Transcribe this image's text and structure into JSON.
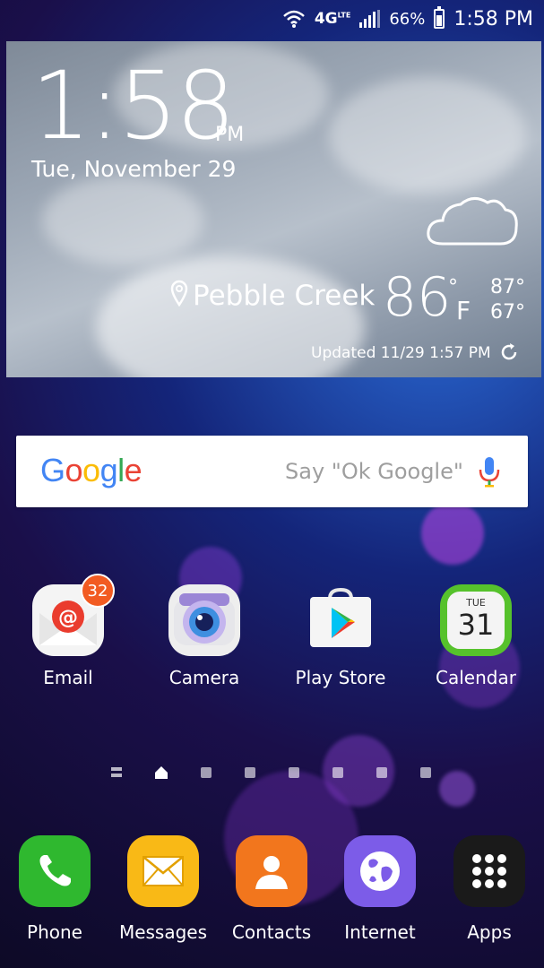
{
  "status_bar": {
    "network": "4G",
    "network_sub": "LTE",
    "battery": "66%",
    "battery_level": 0.66,
    "time": "1:58 PM"
  },
  "weather_widget": {
    "time": "1:58",
    "ampm": "PM",
    "date": "Tue, November 29",
    "location": "Pebble Creek",
    "temperature": "86",
    "degree_symbol": "°",
    "unit": "F",
    "high": "87°",
    "low": "67°",
    "updated": "Updated 11/29 1:57 PM",
    "condition_icon": "cloud-icon"
  },
  "google_search": {
    "logo_letters": [
      "G",
      "o",
      "o",
      "g",
      "l",
      "e"
    ],
    "hint": "Say \"Ok Google\"",
    "colors": {
      "blue": "#4285F4",
      "red": "#EA4335",
      "yellow": "#FBBC05",
      "green": "#34A853"
    }
  },
  "home_apps": [
    {
      "label": "Email",
      "icon": "email-icon",
      "badge": "32"
    },
    {
      "label": "Camera",
      "icon": "camera-icon"
    },
    {
      "label": "Play Store",
      "icon": "play-store-icon"
    },
    {
      "label": "Calendar",
      "icon": "calendar-icon",
      "calendar_day": "TUE",
      "calendar_date": "31"
    }
  ],
  "page_indicator": {
    "pages": 8,
    "current": 1
  },
  "dock": [
    {
      "label": "Phone",
      "icon": "phone-icon",
      "color": "#2fb82f"
    },
    {
      "label": "Messages",
      "icon": "messages-icon",
      "color": "#f9b916"
    },
    {
      "label": "Contacts",
      "icon": "contacts-icon",
      "color": "#f2761d"
    },
    {
      "label": "Internet",
      "icon": "internet-icon",
      "color": "#7c5ce8"
    },
    {
      "label": "Apps",
      "icon": "apps-grid-icon",
      "color": "#1a1a1a"
    }
  ]
}
